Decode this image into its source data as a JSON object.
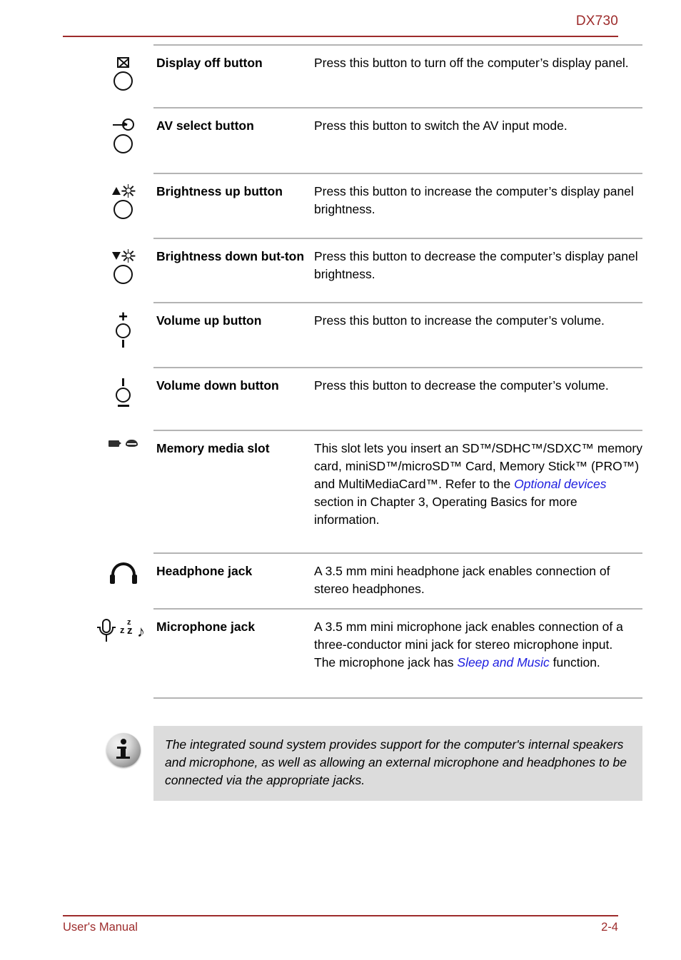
{
  "header": {
    "model": "DX730"
  },
  "rows": [
    {
      "icon": "display-off-icon",
      "name": "Display off button",
      "desc_parts": [
        {
          "text": "Press this button to turn off the computer’s display panel."
        }
      ]
    },
    {
      "icon": "av-select-icon",
      "name": "AV select button",
      "desc_parts": [
        {
          "text": "Press this button to switch the AV input mode."
        }
      ]
    },
    {
      "icon": "brightness-up-icon",
      "name": "Brightness up button",
      "desc_parts": [
        {
          "text": "Press this button to increase the computer’s display panel brightness."
        }
      ]
    },
    {
      "icon": "brightness-down-icon",
      "name": "Brightness down but-ton",
      "desc_parts": [
        {
          "text": "Press this button to decrease the computer’s display panel brightness."
        }
      ]
    },
    {
      "icon": "volume-up-icon",
      "name": "Volume up button",
      "desc_parts": [
        {
          "text": "Press this button to increase the computer’s volume."
        }
      ]
    },
    {
      "icon": "volume-down-icon",
      "name": "Volume down button",
      "desc_parts": [
        {
          "text": "Press this button to decrease the computer’s volume."
        }
      ]
    },
    {
      "icon": "memory-media-slot-icon",
      "name": "Memory media slot",
      "desc_parts": [
        {
          "text": "This slot lets you insert an SD™/SDHC™/SDXC™ memory card, miniSD™/microSD™ Card, Memory Stick™ (PRO™) and MultiMediaCard™. Refer to the "
        },
        {
          "text": "Optional devices",
          "style": "link"
        },
        {
          "text": " section in Chapter 3, Operating Basics for more information."
        }
      ]
    },
    {
      "icon": "headphone-jack-icon",
      "name": "Headphone jack",
      "desc_parts": [
        {
          "text": "A 3.5 mm mini headphone jack enables connection of stereo headphones."
        }
      ]
    },
    {
      "icon": "microphone-jack-icon",
      "name": "Microphone jack",
      "desc_parts": [
        {
          "text": "A 3.5 mm mini microphone jack enables connection of a three-conductor mini jack for stereo microphone input."
        },
        {
          "text": "\n",
          "style": "break"
        },
        {
          "text": "The microphone jack has "
        },
        {
          "text": "Sleep and Music",
          "style": "link"
        },
        {
          "text": " function."
        }
      ]
    }
  ],
  "note": {
    "icon": "info-icon",
    "text": "The integrated sound system provides support for the computer's internal speakers and microphone, as well as allowing an external microphone and headphones to be connected via the appropriate jacks."
  },
  "footer": {
    "left": "User's Manual",
    "right": "2-4"
  },
  "colors": {
    "accent_red": "#9d2b2b",
    "link_blue": "#1d1de0",
    "rule_grey": "#b4b4b4",
    "note_bg": "#dcdcdc"
  }
}
